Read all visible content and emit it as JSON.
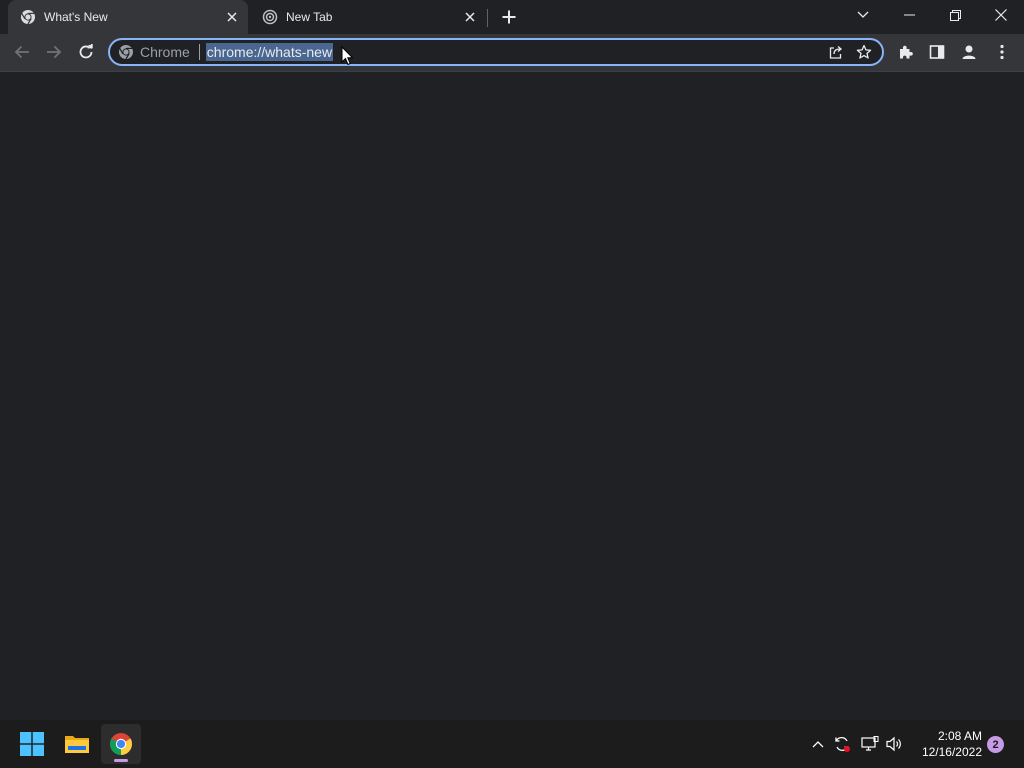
{
  "tabs": [
    {
      "title": "What's New",
      "icon": "chrome-icon",
      "active": true
    },
    {
      "title": "New Tab",
      "icon": "new-tab-icon",
      "active": false
    }
  ],
  "omnibox": {
    "chip_label": "Chrome",
    "url": "chrome://whats-new"
  },
  "taskbar": {
    "time": "2:08 AM",
    "date": "12/16/2022",
    "notification_count": "2"
  },
  "colors": {
    "background": "#202124",
    "toolbar": "#35363a",
    "accent": "#8ab4f8",
    "selection": "#4a6791",
    "taskbar": "#1c1c1c",
    "notification": "#c79ae6"
  }
}
